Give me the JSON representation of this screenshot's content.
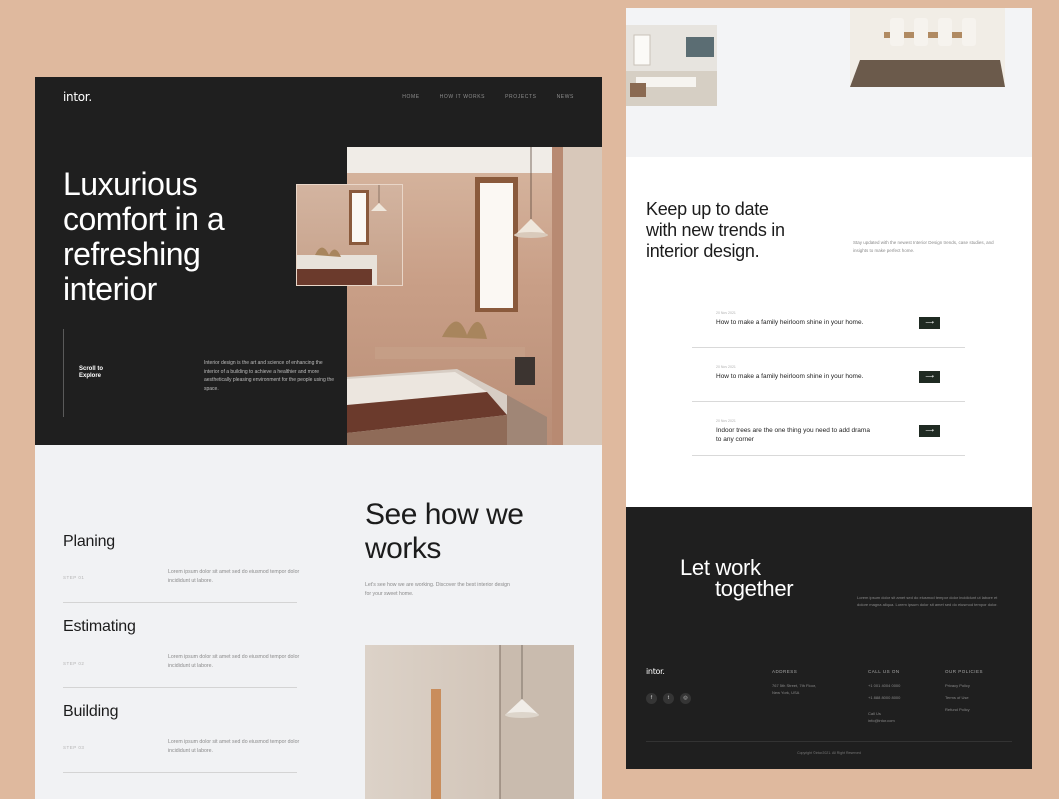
{
  "colors": {
    "background": "#dfb99e",
    "dark": "#1f1f1f",
    "light": "#f1f2f4",
    "accent_button": "#1f2a22"
  },
  "hero": {
    "logo": "intor.",
    "nav": [
      "HOME",
      "HOW IT WORKS",
      "PROJECTS",
      "NEWS"
    ],
    "title_lines": [
      "Luxurious",
      "comfort in a",
      "refreshing",
      "interior"
    ],
    "scroll_lines": [
      "Scroll to",
      "Explore"
    ],
    "description": "Interior design is the art and science of enhancing the interior of a building to achieve a healthier and more aesthetically pleasing environment for the people using the space."
  },
  "process": {
    "steps": [
      {
        "title": "Planing",
        "number": "STEP 01",
        "description": "Lorem ipsum dolor sit amet sed do eiusmod tempor dolor incididunt ut labore."
      },
      {
        "title": "Estimating",
        "number": "STEP 02",
        "description": "Lorem ipsum dolor sit amet sed do eiusmod tempor dolor incididunt ut labore."
      },
      {
        "title": "Building",
        "number": "STEP 03",
        "description": "Lorem ipsum dolor sit amet sed do eiusmod tempor dolor incididunt ut labore."
      }
    ],
    "heading_lines": [
      "See how we",
      "works"
    ],
    "description": "Let's see how we are working. Discover the best interior design for your sweet home."
  },
  "trends": {
    "heading_lines": [
      "Keep up to date",
      "with new trends in",
      "interior design."
    ],
    "description": "Stay updated with the newest Interior Design trends, case studies, and insights to make perfect home.",
    "articles": [
      {
        "date": "20 Nov 2021",
        "title": "How to make a family heirloom shine in your home.",
        "button": "⟶"
      },
      {
        "date": "20 Nov 2021",
        "title": "How to make a family heirloom shine in your home.",
        "button": "⟶"
      },
      {
        "date": "20 Nov 2021",
        "title": "Indoor trees are the one thing you need to add drama to any corner",
        "button": "⟶"
      }
    ]
  },
  "footer": {
    "cta_line1": "Let work",
    "cta_line2": "together",
    "cta_description": "Lorem ipsum dolor sit amet sed do eiusmod tempor dolor incididunt ut labore et dolore magna aliqua. Lorem ipsum dolor sit amet sed do eiusmod tempor dolor.",
    "logo": "intor.",
    "socials": [
      {
        "icon": "facebook-icon",
        "glyph": "f"
      },
      {
        "icon": "twitter-icon",
        "glyph": "t"
      },
      {
        "icon": "instagram-icon",
        "glyph": "◎"
      }
    ],
    "columns": [
      {
        "head": "ADDRESS",
        "lines": [
          "767 5th Street, 7th Floor,",
          "New York, USA"
        ]
      },
      {
        "head": "CALL US ON",
        "lines": [
          "+1 001 4004 0000",
          "+1 888 8000 8000",
          "",
          "Call Us",
          "info@intor.com"
        ]
      },
      {
        "head": "OUR POLICIES",
        "lines": [
          "Privacy Policy",
          "Terms of Use",
          "Refund Policy"
        ]
      }
    ],
    "copyright": "Copyright ©intor2021. All Right Reserved"
  }
}
